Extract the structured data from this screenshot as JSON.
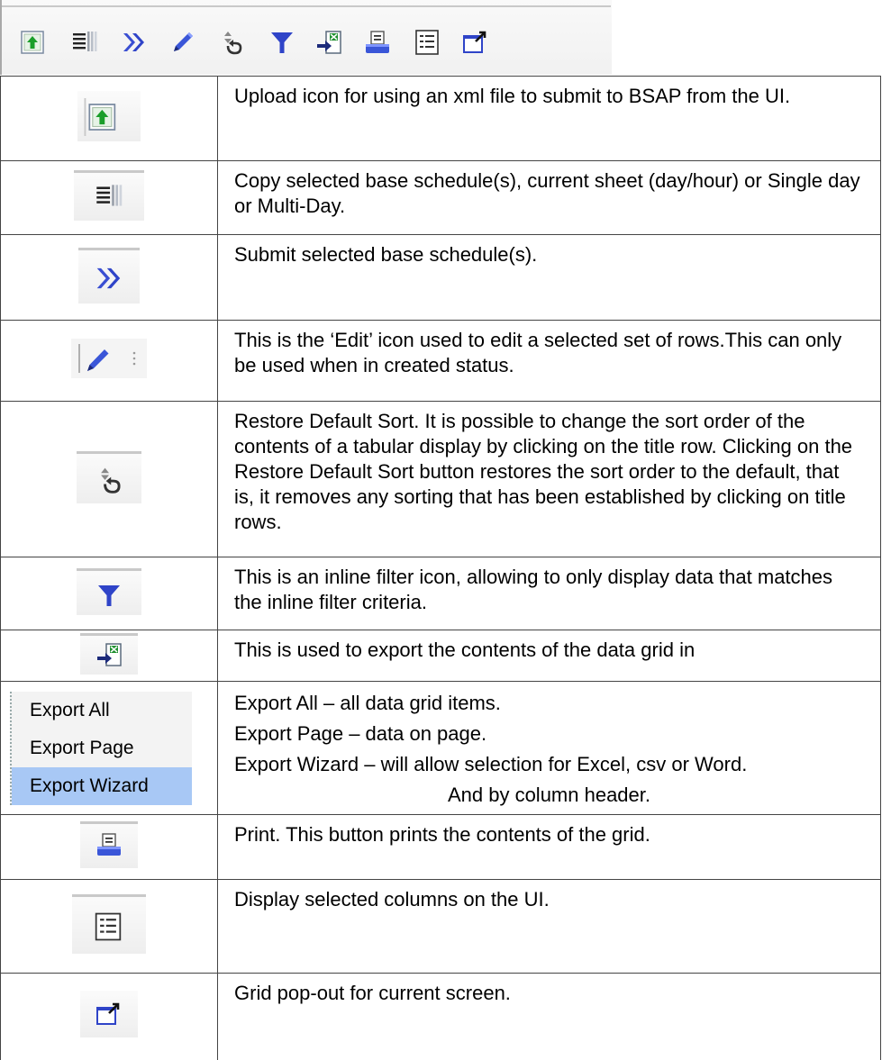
{
  "toolbar": {
    "icons": [
      "upload-icon",
      "copy-icon",
      "submit-icon",
      "edit-icon",
      "restore-sort-icon",
      "filter-icon",
      "export-icon",
      "print-icon",
      "columns-icon",
      "popout-icon"
    ]
  },
  "rows": [
    {
      "icon": "upload-icon",
      "text": "Upload icon for using an xml file to submit to BSAP from the UI."
    },
    {
      "icon": "copy-icon",
      "text": "Copy selected base schedule(s), current sheet (day/hour) or Single day or Multi-Day."
    },
    {
      "icon": "submit-icon",
      "text": "Submit selected base schedule(s)."
    },
    {
      "icon": "edit-icon",
      "text": "This is the ‘Edit’ icon used to edit a selected set of rows.This can only be used when in created status."
    },
    {
      "icon": "restore-sort-icon",
      "text": "Restore Default Sort.  It is possible to change the sort order of the contents of a tabular display by clicking on the title row. Clicking on the Restore Default Sort button restores the sort order to the default, that is, it removes any sorting that has been established by clicking on title rows."
    },
    {
      "icon": "filter-icon",
      "text": "This is an inline filter icon, allowing to only display data that matches the inline filter criteria."
    },
    {
      "icon": "export-icon",
      "text": "This is used to export the contents of the data grid in"
    },
    {
      "menu": [
        "Export All",
        "Export Page",
        "Export Wizard"
      ],
      "lines": [
        "Export All – all data grid items.",
        "Export Page – data on page.",
        "Export Wizard – will allow selection for Excel, csv or Word.",
        "And by column header."
      ]
    },
    {
      "icon": "print-icon",
      "text": "Print.  This button prints the contents of the grid."
    },
    {
      "icon": "columns-icon",
      "text": "Display selected columns on the UI."
    },
    {
      "icon": "popout-icon",
      "text": "Grid pop-out for current screen."
    }
  ],
  "colors": {
    "accent_blue": "#2f44c8",
    "border": "#444444",
    "menu_highlight": "#a8c8f5"
  }
}
